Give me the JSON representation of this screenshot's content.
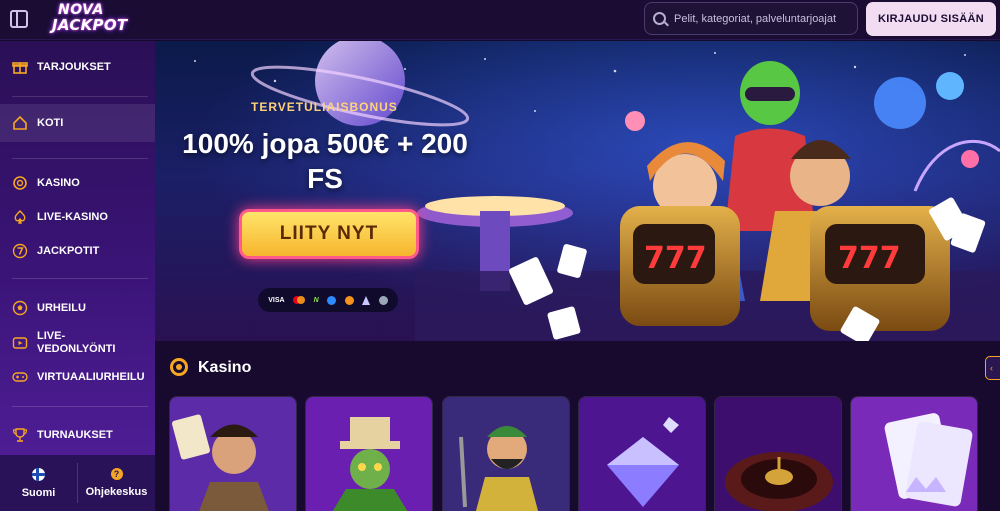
{
  "header": {
    "logo_line1": "NOVA",
    "logo_line2": "JACKPOT",
    "search_placeholder": "Pelit, kategoriat, palveluntarjoajat",
    "login_label": "KIRJAUDU SISÄÄN"
  },
  "sidebar": {
    "items": [
      {
        "label": "TARJOUKSET",
        "icon": "gift-icon"
      },
      {
        "label": "KOTI",
        "icon": "home-icon",
        "active": true
      },
      {
        "label": "KASINO",
        "icon": "chip-icon"
      },
      {
        "label": "LIVE-KASINO",
        "icon": "spade-icon"
      },
      {
        "label": "JACKPOTIT",
        "icon": "seven-icon"
      },
      {
        "label": "URHEILU",
        "icon": "soccer-ball-icon"
      },
      {
        "label": "LIVE-VEDONLYÖNTI",
        "label_line1": "LIVE-",
        "label_line2": "VEDONLYÖNTI",
        "icon": "live-play-icon"
      },
      {
        "label": "VIRTUAALIURHEILU",
        "icon": "gamepad-icon"
      },
      {
        "label": "TURNAUKSET",
        "icon": "trophy-icon"
      }
    ],
    "footer": {
      "language_label": "Suomi",
      "help_label": "Ohjekeskus"
    }
  },
  "hero": {
    "subtitle": "TERVETULIAISBONUS",
    "title": "100% jopa 500€ + 200 FS",
    "cta_label": "LIITY NYT",
    "slot_text_left": "777",
    "slot_text_right": "777",
    "payments": [
      "visa",
      "mastercard",
      "neteller",
      "ripple",
      "bitcoin",
      "ethereum",
      "litecoin"
    ],
    "payment_visa_text": "VISA",
    "payment_neteller_text": "N"
  },
  "casino_section": {
    "title": "Kasino",
    "tiles": [
      "adventurer-game",
      "leprechaun-game",
      "lumberjack-game",
      "diamond-game",
      "roulette-game",
      "cards-crown-game"
    ]
  },
  "colors": {
    "accent": "#f5a623",
    "sidebar_top": "#2a0f56",
    "sidebar_bottom": "#54209e",
    "login_bg": "#f2dcf2",
    "cta_yellow": "#ffd84a",
    "cta_border": "#ff5a8a"
  }
}
